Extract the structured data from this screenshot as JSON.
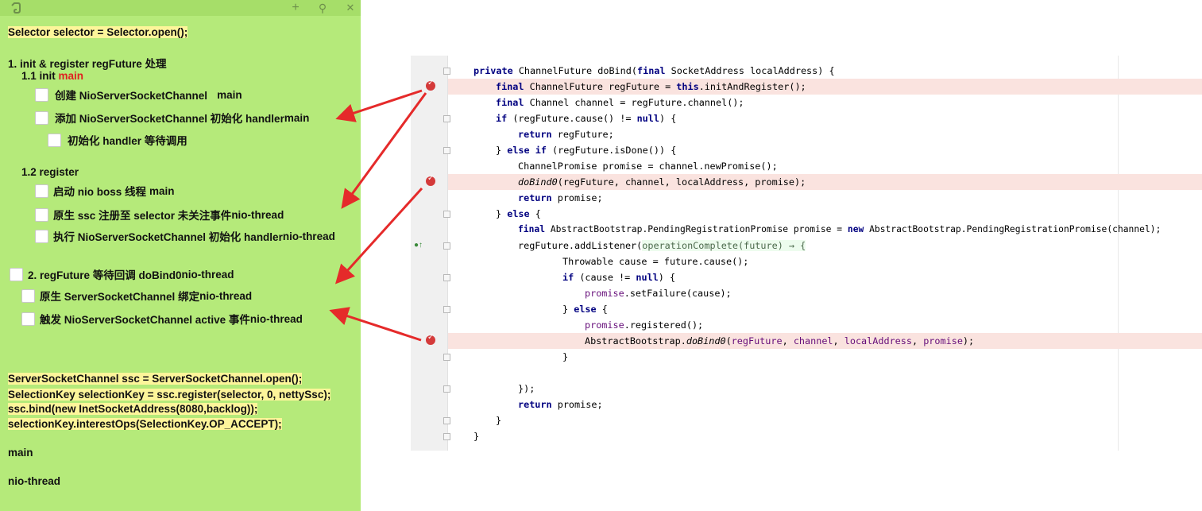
{
  "note": {
    "controls": {
      "add": "+",
      "pin": "⚲",
      "close": "✕"
    },
    "selector_line": "Selector selector = Selector.open();",
    "section1_title": "1. init & register regFuture 处理",
    "s11_label": "1.1 init ",
    "s11_thread": "main",
    "items_init": [
      {
        "text": "创建 NioServerSocketChannel",
        "thread": "main"
      },
      {
        "text": "添加 NioServerSocketChannel 初始化 handler ",
        "thread": "main"
      },
      {
        "text": "初始化 handler 等待调用",
        "thread": ""
      }
    ],
    "s12_label": "1.2 register",
    "items_register": [
      {
        "text": "启动 nio boss 线程 ",
        "thread": "main"
      },
      {
        "text": "原生 ssc 注册至 selector 未关注事件 ",
        "thread": "nio-thread"
      },
      {
        "text": "执行 NioServerSocketChannel 初始化 handler ",
        "thread": "nio-thread"
      }
    ],
    "section2": {
      "text": "2. regFuture 等待回调 doBind0 ",
      "thread": "nio-thread"
    },
    "items_bind": [
      {
        "text": "原生 ServerSocketChannel 绑定 ",
        "thread": "nio-thread"
      },
      {
        "text": "触发 NioServerSocketChannel active 事件 ",
        "thread": "nio-thread"
      }
    ],
    "code_lines": [
      "ServerSocketChannel ssc = ServerSocketChannel.open();",
      "SelectionKey selectionKey = ssc.register(selector, 0, nettySsc);",
      "ssc.bind(new InetSocketAddress(8080,backlog));",
      "selectionKey.interestOps(SelectionKey.OP_ACCEPT);"
    ],
    "legend_main": "main",
    "legend_nio": "nio-thread"
  },
  "colors": {
    "note_bg": "#b5ea7a",
    "red": "#e02020",
    "purple": "#a023b8",
    "breakpoint_line": "#fae3df"
  },
  "editor": {
    "l01_kw1": "private",
    "l01_rest": " ChannelFuture doBind(",
    "l01_kw2": "final",
    "l01_rest2": " SocketAddress localAddress) {",
    "l02_kw": "final",
    "l02_rest": " ChannelFuture regFuture = ",
    "l02_this": "this",
    "l02_rest2": ".initAndRegister();",
    "l03_kw": "final",
    "l03_rest": " Channel channel = regFuture.channel();",
    "l04_kw": "if",
    "l04_rest": " (regFuture.cause() != ",
    "l04_null": "null",
    "l04_rest2": ") {",
    "l05_kw": "return",
    "l05_rest": " regFuture;",
    "l06_a": "} ",
    "l06_kw": "else if",
    "l06_rest": " (regFuture.isDone()) {",
    "l07_text": "ChannelPromise promise = channel.newPromise();",
    "l08_it": "doBind0",
    "l08_rest": "(regFuture, channel, localAddress, promise);",
    "l09_kw": "return",
    "l09_rest": " promise;",
    "l10_a": "} ",
    "l10_kw": "else",
    "l10_rest": " {",
    "l11_kw": "final",
    "l11_rest": " AbstractBootstrap.PendingRegistrationPromise promise = ",
    "l11_new": "new",
    "l11_rest2": " AbstractBootstrap.PendingRegistrationPromise(channel);",
    "l12_a": "regFuture.addListener(",
    "l12_lam": "operationComplete(future) → {",
    "l13_text": "Throwable cause = future.cause();",
    "l14_kw": "if",
    "l14_rest": " (cause != ",
    "l14_null": "null",
    "l14_rest2": ") {",
    "l15_pu": "promise",
    "l15_rest": ".setFailure(cause);",
    "l16_a": "} ",
    "l16_kw": "else",
    "l16_rest": " {",
    "l17_pu": "promise",
    "l17_rest": ".registered();",
    "l18_a": "AbstractBootstrap.",
    "l18_it": "doBind0",
    "l18_b": "(",
    "l18_p1": "regFuture",
    "l18_c": ", ",
    "l18_p2": "channel",
    "l18_d": ", ",
    "l18_p3": "localAddress",
    "l18_e": ", ",
    "l18_p4": "promise",
    "l18_f": ");",
    "l19_text": "}",
    "l21_text": "});",
    "l22_kw": "return",
    "l22_rest": " promise;",
    "l23_text": "}",
    "l24_text": "}"
  }
}
